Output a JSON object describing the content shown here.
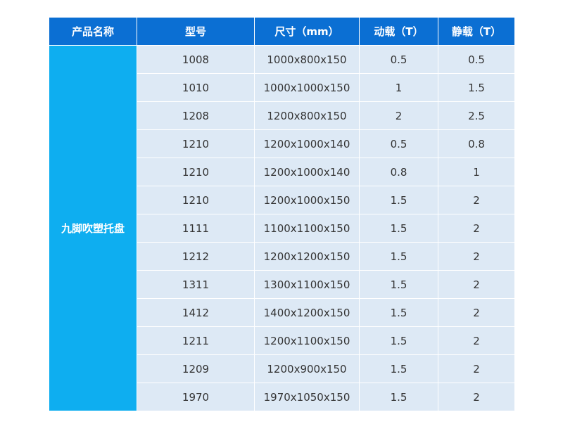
{
  "table": {
    "headers": [
      "产品名称",
      "型号",
      "尺寸（mm）",
      "动载（T）",
      "静载（T）"
    ],
    "product_name": "九脚吹塑托盘",
    "rows": [
      {
        "model": "1008",
        "size": "1000x800x150",
        "dynamic": "0.5",
        "static": "0.5"
      },
      {
        "model": "1010",
        "size": "1000x1000x150",
        "dynamic": "1",
        "static": "1.5"
      },
      {
        "model": "1208",
        "size": "1200x800x150",
        "dynamic": "2",
        "static": "2.5"
      },
      {
        "model": "1210",
        "size": "1200x1000x140",
        "dynamic": "0.5",
        "static": "0.8"
      },
      {
        "model": "1210",
        "size": "1200x1000x140",
        "dynamic": "0.8",
        "static": "1"
      },
      {
        "model": "1210",
        "size": "1200x1000x150",
        "dynamic": "1.5",
        "static": "2"
      },
      {
        "model": "1111",
        "size": "1100x1100x150",
        "dynamic": "1.5",
        "static": "2"
      },
      {
        "model": "1212",
        "size": "1200x1200x150",
        "dynamic": "1.5",
        "static": "2"
      },
      {
        "model": "1311",
        "size": "1300x1100x150",
        "dynamic": "1.5",
        "static": "2"
      },
      {
        "model": "1412",
        "size": "1400x1200x150",
        "dynamic": "1.5",
        "static": "2"
      },
      {
        "model": "1211",
        "size": "1200x1100x150",
        "dynamic": "1.5",
        "static": "2"
      },
      {
        "model": "1209",
        "size": "1200x900x150",
        "dynamic": "1.5",
        "static": "2"
      },
      {
        "model": "1970",
        "size": "1970x1050x150",
        "dynamic": "1.5",
        "static": "2"
      }
    ]
  },
  "colors": {
    "header_bg": "#0b6fd3",
    "product_cell_bg": "#0eaef0",
    "body_cell_bg": "#dde9f5",
    "body_text": "#333333"
  }
}
